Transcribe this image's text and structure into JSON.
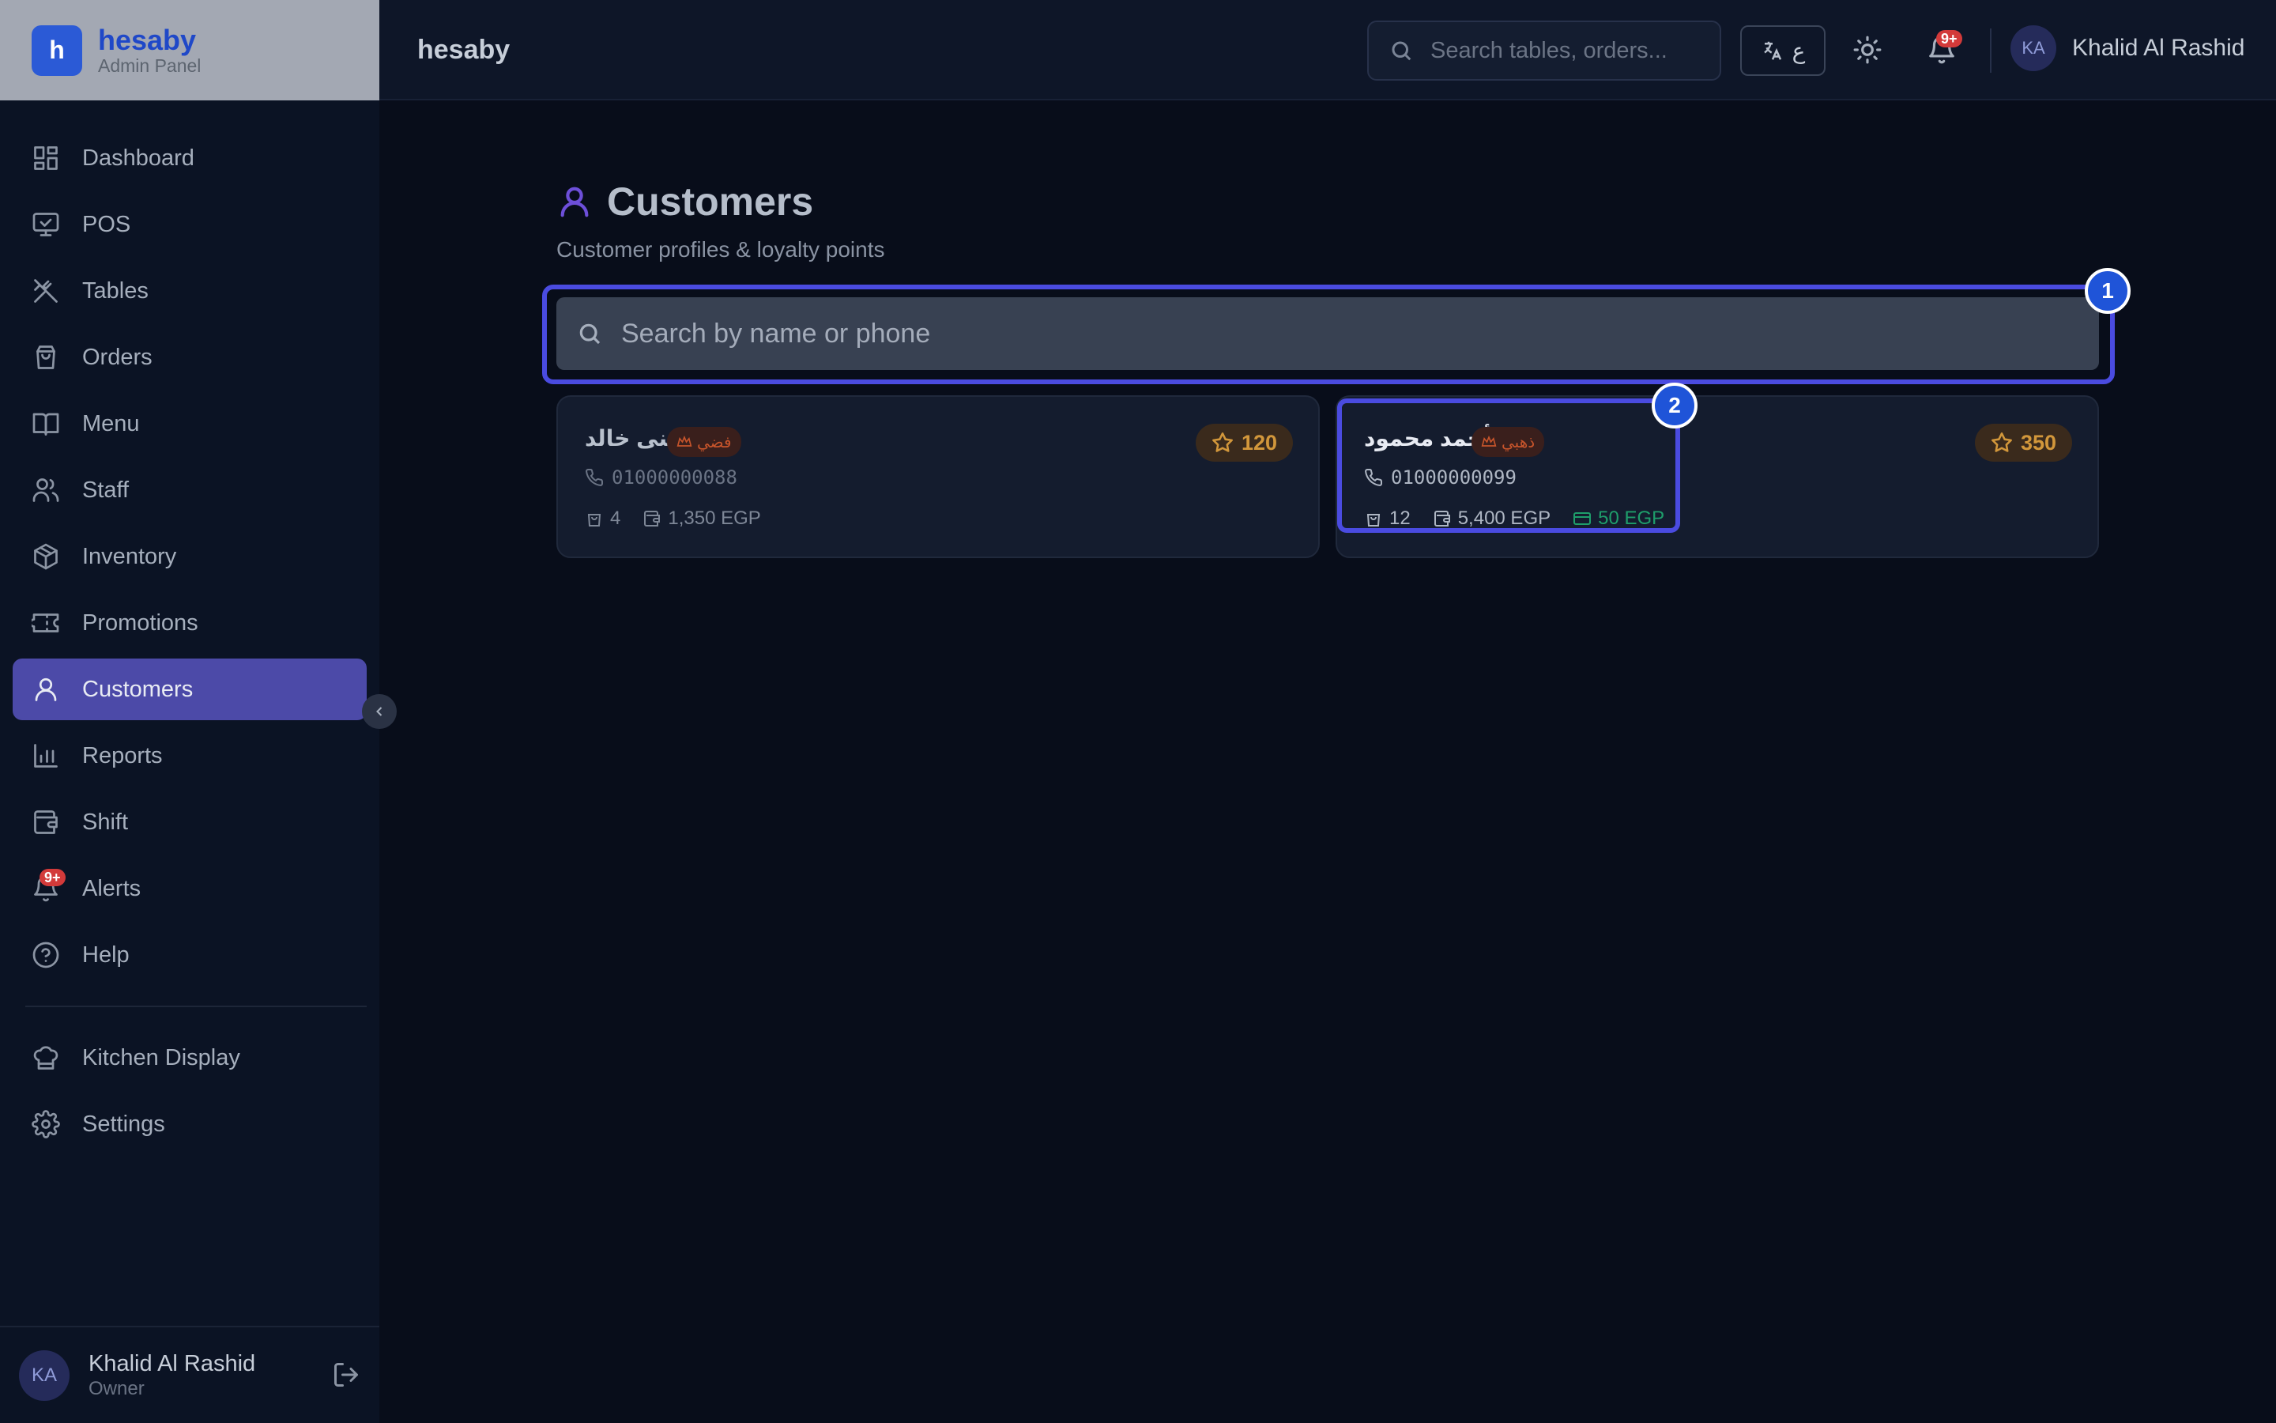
{
  "brand": {
    "name": "hesaby",
    "subtitle": "Admin Panel",
    "logo_letter": "h"
  },
  "sidebar": {
    "items": [
      {
        "label": "Dashboard",
        "icon": "dashboard-icon"
      },
      {
        "label": "POS",
        "icon": "monitor-icon"
      },
      {
        "label": "Tables",
        "icon": "utensils-icon"
      },
      {
        "label": "Orders",
        "icon": "shopping-bag-icon"
      },
      {
        "label": "Menu",
        "icon": "book-icon"
      },
      {
        "label": "Staff",
        "icon": "users-icon"
      },
      {
        "label": "Inventory",
        "icon": "package-icon"
      },
      {
        "label": "Promotions",
        "icon": "ticket-icon"
      },
      {
        "label": "Customers",
        "icon": "user-icon",
        "active": true
      },
      {
        "label": "Reports",
        "icon": "bar-chart-icon"
      },
      {
        "label": "Shift",
        "icon": "wallet-icon"
      },
      {
        "label": "Alerts",
        "icon": "bell-icon",
        "badge": "9+"
      },
      {
        "label": "Help",
        "icon": "help-circle-icon"
      },
      {
        "label": "Kitchen Display",
        "icon": "chef-hat-icon"
      },
      {
        "label": "Settings",
        "icon": "gear-icon"
      }
    ],
    "user": {
      "initials": "KA",
      "name": "Khalid Al Rashid",
      "role": "Owner"
    }
  },
  "topbar": {
    "title": "hesaby",
    "search_placeholder": "Search tables, orders...",
    "lang_label": "ع",
    "notification_badge": "9+",
    "user": {
      "initials": "KA",
      "name": "Khalid Al Rashid"
    }
  },
  "main": {
    "title": "Customers",
    "subtitle": "Customer profiles & loyalty points",
    "search_placeholder": "Search by name or phone",
    "markers": [
      "1",
      "2"
    ],
    "customers": [
      {
        "name": "منى خالد",
        "tier": "فضي",
        "points": "120",
        "phone": "01000000088",
        "orders": "4",
        "spent": "1,350 EGP",
        "credit": ""
      },
      {
        "name": "أحمد محمود",
        "tier": "ذهبي",
        "points": "350",
        "phone": "01000000099",
        "orders": "12",
        "spent": "5,400 EGP",
        "credit": "50 EGP"
      }
    ]
  },
  "colors": {
    "accent": "#4c4aa8",
    "marker": "#1f54d8",
    "points": "#d2973b",
    "tier": "#c6542b",
    "credit": "#1e9e6b"
  }
}
